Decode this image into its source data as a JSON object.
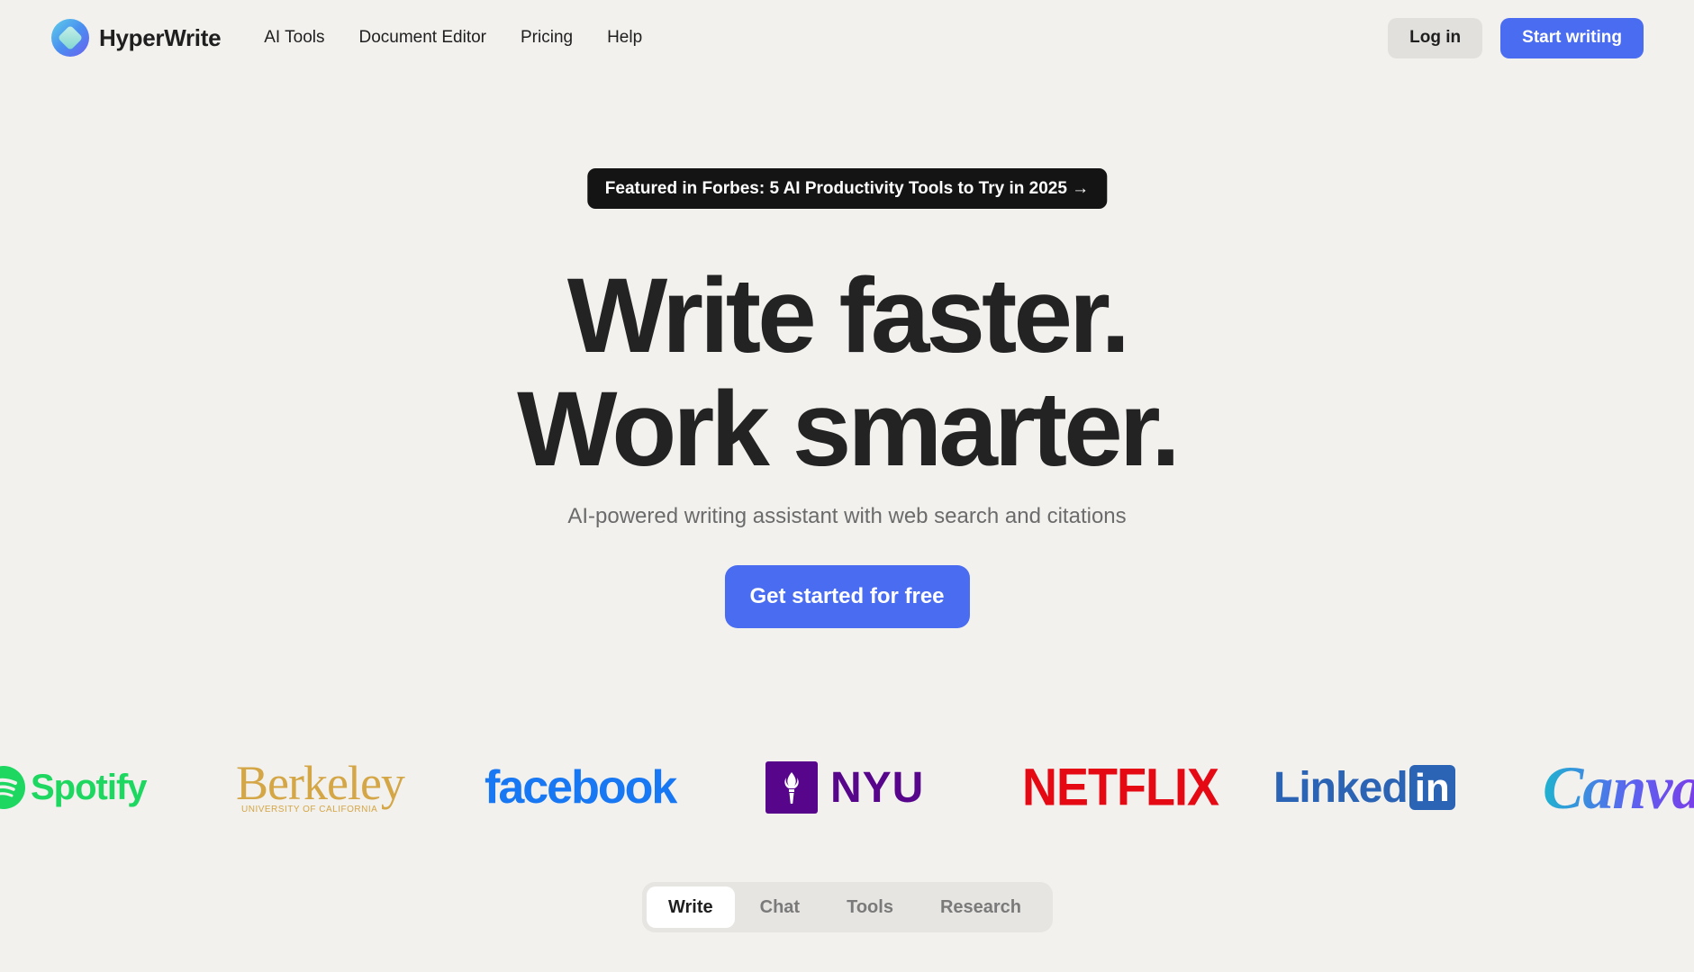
{
  "nav": {
    "brand": "HyperWrite",
    "links": [
      "AI Tools",
      "Document Editor",
      "Pricing",
      "Help"
    ],
    "login_label": "Log in",
    "start_label": "Start writing"
  },
  "hero": {
    "badge": "Featured in Forbes: 5 AI Productivity Tools to Try in 2025 →",
    "headline_line1": "Write faster.",
    "headline_line2": "Work smarter.",
    "subhead": "AI-powered writing assistant with web search and citations",
    "cta_label": "Get started for free"
  },
  "logos": {
    "spotify": "Spotify",
    "berkeley": "Berkeley",
    "berkeley_sub": "UNIVERSITY OF CALIFORNIA",
    "facebook": "facebook",
    "nyu": "NYU",
    "netflix": "NETFLIX",
    "linkedin": "Linked",
    "linkedin_in": "in",
    "canva": "Canva"
  },
  "tabs": {
    "items": [
      "Write",
      "Chat",
      "Tools",
      "Research"
    ],
    "active": "Write"
  },
  "colors": {
    "accent": "#4a6cf0",
    "background": "#f2f1ee",
    "badge_bg": "#141414"
  }
}
